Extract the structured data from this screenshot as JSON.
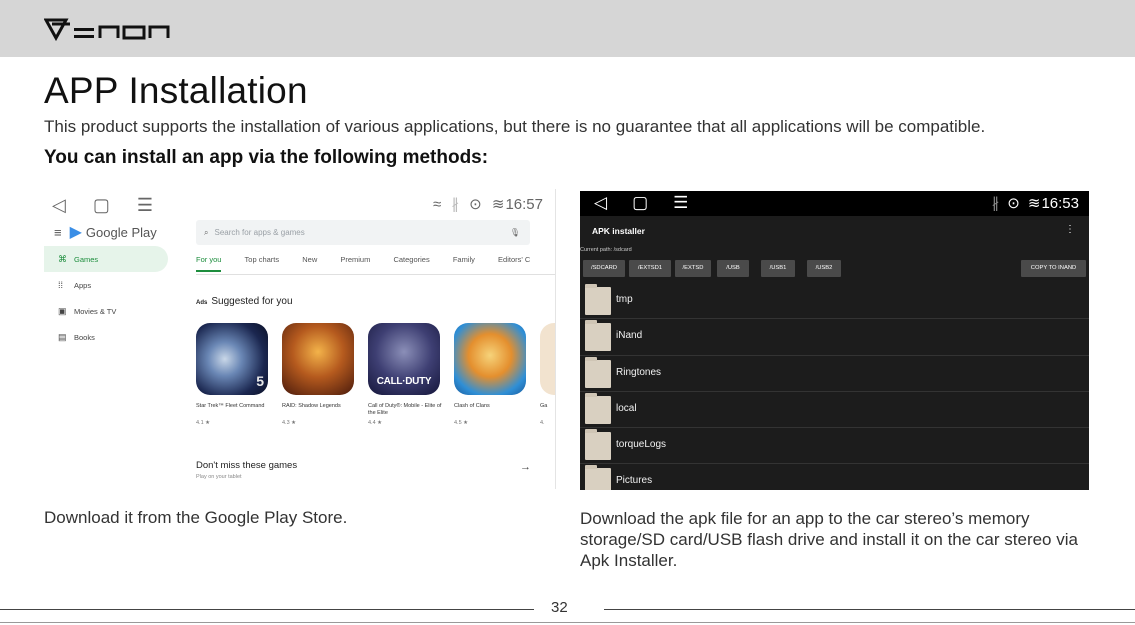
{
  "header": {
    "brand": "Eonon"
  },
  "page": {
    "title": "APP Installation",
    "intro": "This product supports the installation of various applications, but there is no guarantee that all applications will be compatible.",
    "methods_heading": "You can install an app via the following methods:",
    "page_number": "32"
  },
  "google_play": {
    "nav_icons": [
      "back-icon",
      "home-icon",
      "menu-icon"
    ],
    "time": "16:57",
    "brand": "Google Play",
    "sidebar": [
      {
        "label": "Games",
        "icon": "gamepad-icon",
        "active": true
      },
      {
        "label": "Apps",
        "icon": "apps-grid-icon",
        "active": false
      },
      {
        "label": "Movies & TV",
        "icon": "movie-icon",
        "active": false
      },
      {
        "label": "Books",
        "icon": "book-icon",
        "active": false
      }
    ],
    "search_placeholder": "Search for apps & games",
    "tabs": [
      "For you",
      "Top charts",
      "New",
      "Premium",
      "Categories",
      "Family",
      "Editors' C"
    ],
    "ads_label": "Ads",
    "suggested_heading": "Suggested for you",
    "apps": [
      {
        "name": "Star Trek™ Fleet Command",
        "rating": "4.1 ★"
      },
      {
        "name": "RAID: Shadow Legends",
        "rating": "4.3 ★"
      },
      {
        "name": "Call of Duty®: Mobile - Elite of the Elite",
        "rating": "4.4 ★"
      },
      {
        "name": "Clash of Clans",
        "rating": "4.5 ★"
      },
      {
        "name": "Ga",
        "rating": "4."
      }
    ],
    "cod_logo_text": "CALL·DUTY",
    "dont_miss": "Don't miss these games",
    "dont_miss_sub": "Play on your tablet"
  },
  "apk_installer": {
    "time": "16:53",
    "title": "APK installer",
    "current_path": "Current path: /sdcard",
    "buttons": [
      "/SDCARD",
      "/EXTSD1",
      "/EXTSD",
      "/USB",
      "/USB1",
      "/USB2"
    ],
    "copy_button": "COPY TO INAND",
    "folders": [
      "tmp",
      "iNand",
      "Ringtones",
      "local",
      "torqueLogs",
      "Pictures"
    ]
  },
  "captions": {
    "left": "Download it from the Google Play Store.",
    "right": "Download the apk file for an app to the car stereo’s memory storage/SD card/USB flash drive and install it on the car stereo via Apk Installer."
  },
  "colors": {
    "header_bar": "#d6d6d6",
    "play_green": "#1e8e3e",
    "apk_background": "#1c1c1c"
  }
}
